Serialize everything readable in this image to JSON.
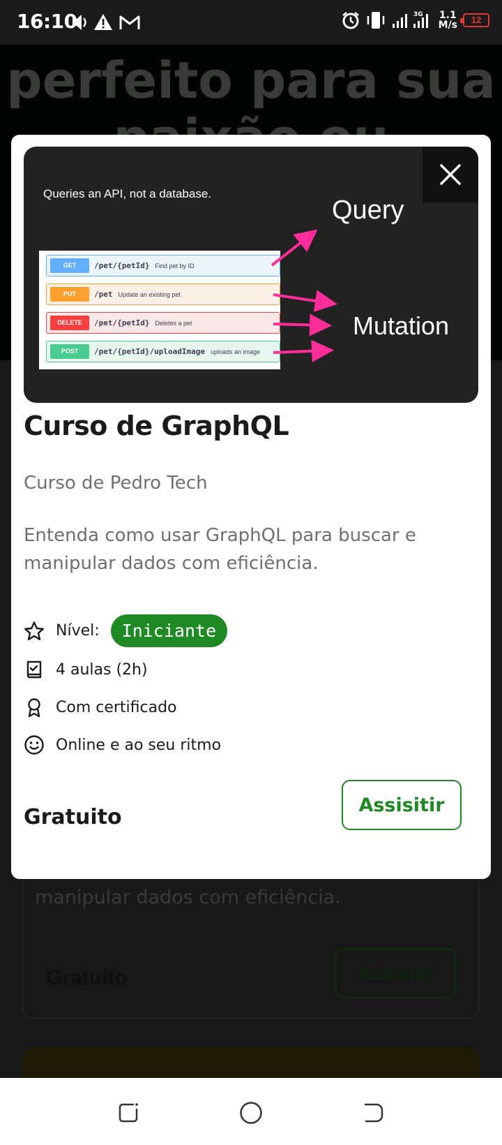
{
  "status_bar": {
    "time": "16:10",
    "network_speed_value": "1.1",
    "network_speed_unit": "M/s",
    "battery_level": "12",
    "signal_tag": "3G"
  },
  "background": {
    "hero_line1": "perfeito para sua",
    "hero_line2": "paixão ou carreira",
    "card_description": "manipular dados com eficiência.",
    "card_price": "Gratuito",
    "card_button": "Assisitir"
  },
  "modal": {
    "preview": {
      "caption": "Queries an API, not a database.",
      "query_label": "Query",
      "mutation_label": "Mutation",
      "endpoints": [
        {
          "method": "GET",
          "path": "/pet/{petId}",
          "description": "Find pet by ID"
        },
        {
          "method": "PUT",
          "path": "/pet",
          "description": "Update an existing pet"
        },
        {
          "method": "DELETE",
          "path": "/pet/{petId}",
          "description": "Deletes a pet"
        },
        {
          "method": "POST",
          "path": "/pet/{petId}/uploadImage",
          "description": "uploads an image"
        }
      ]
    },
    "title": "Curso de GraphQL",
    "author": "Curso de Pedro Tech",
    "description": "Entenda como usar GraphQL para buscar e manipular dados com eficiência.",
    "features": {
      "level_label": "Nível:",
      "level_value": "Iniciante",
      "lessons": "4 aulas (2h)",
      "certificate": "Com certificado",
      "online": "Online e ao seu ritmo"
    },
    "price": "Gratuito",
    "watch_button": "Assisitir"
  },
  "colors": {
    "accent_green": "#1f8a24",
    "arrow_pink": "#ff2d9a"
  }
}
